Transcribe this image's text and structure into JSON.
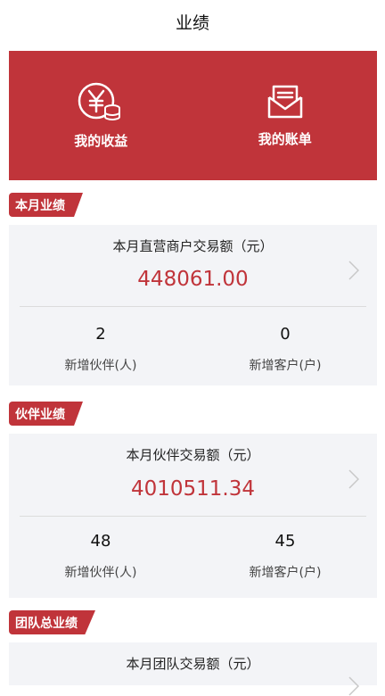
{
  "header": {
    "title": "业绩"
  },
  "banner": {
    "income_label": "我的收益",
    "bill_label": "我的账单",
    "income_icon": "yen-coins-icon",
    "bill_icon": "envelope-bill-icon"
  },
  "sections": [
    {
      "tag": "本月业绩",
      "title": "本月直营商户交易额（元）",
      "amount": "448061.00",
      "stats": [
        {
          "value": "2",
          "label": "新增伙伴(人)"
        },
        {
          "value": "0",
          "label": "新增客户(户)"
        }
      ]
    },
    {
      "tag": "伙伴业绩",
      "title": "本月伙伴交易额（元）",
      "amount": "4010511.34",
      "stats": [
        {
          "value": "48",
          "label": "新增伙伴(人)"
        },
        {
          "value": "45",
          "label": "新增客户(户)"
        }
      ]
    },
    {
      "tag": "团队总业绩",
      "title": "本月团队交易额（元）"
    }
  ],
  "colors": {
    "accent": "#c0343a",
    "card_bg": "#f3f4f7"
  }
}
